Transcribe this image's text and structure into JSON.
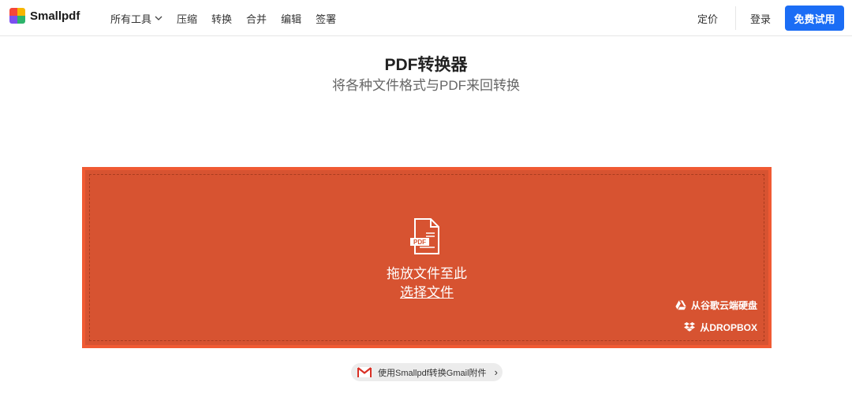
{
  "header": {
    "brand": "Smallpdf",
    "nav": [
      {
        "label": "所有工具",
        "dropdown": true
      },
      {
        "label": "压缩"
      },
      {
        "label": "转换"
      },
      {
        "label": "合并"
      },
      {
        "label": "编辑"
      },
      {
        "label": "签署"
      }
    ],
    "pricing": "定价",
    "login": "登录",
    "trial": "免费试用"
  },
  "main": {
    "title": "PDF转换器",
    "subtitle": "将各种文件格式与PDF来回转换"
  },
  "dropzone": {
    "icon": "pdf-file-icon",
    "icon_badge": "PDF",
    "prompt": "拖放文件至此",
    "choose": "选择文件",
    "google_drive": "从谷歌云端硬盘",
    "dropbox": "从DROPBOX"
  },
  "gmail": {
    "label": "使用Smallpdf转换Gmail附件"
  },
  "colors": {
    "accent": "#1b6df5",
    "dropzone": "#d75331",
    "dropzone_border": "#f05a33"
  }
}
